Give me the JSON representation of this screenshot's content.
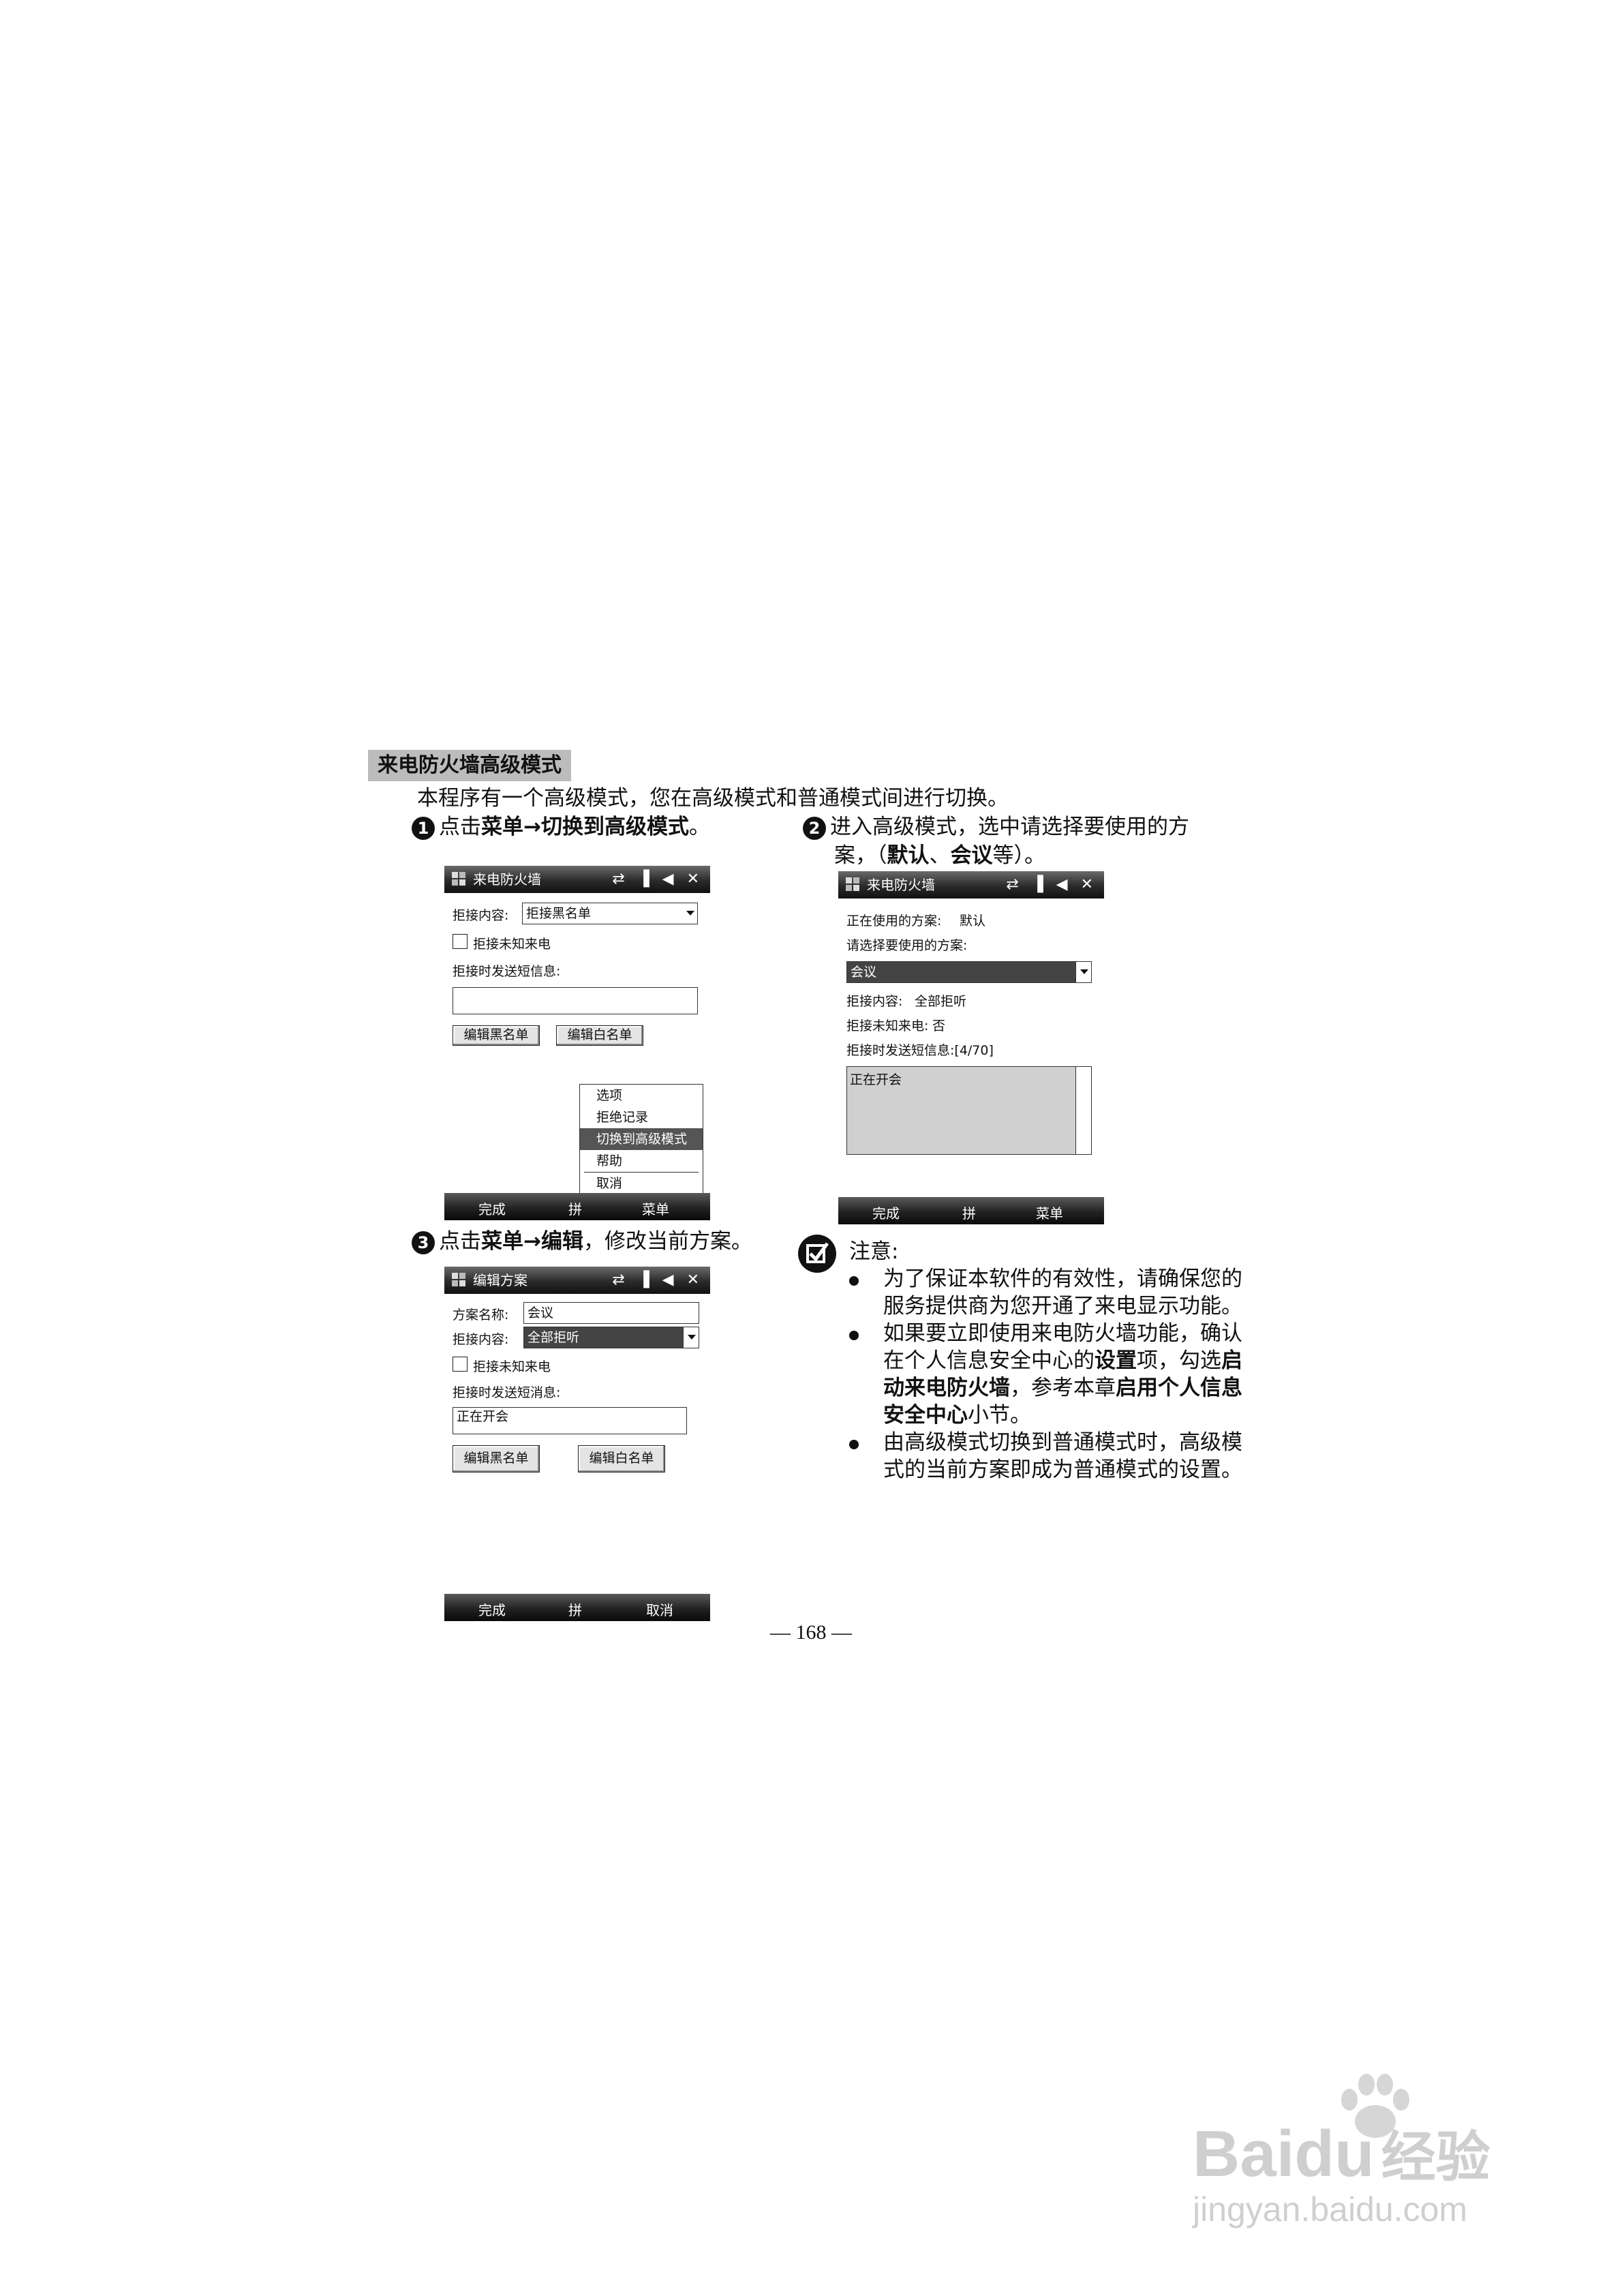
{
  "section_title": "来电防火墙高级模式",
  "intro": "本程序有一个高级模式，您在高级模式和普通模式间进行切换。",
  "step1": {
    "num": "1",
    "pre": "点击",
    "b1": "菜单",
    "arrow": "→",
    "b2": "切换到高级模式",
    "post": "。"
  },
  "step2": {
    "num": "2",
    "line1": "进入高级模式，选中请选择要使用的方",
    "line2_pre": "案，（",
    "b1": "默认",
    "sep": "、",
    "b2": "会议",
    "line2_post": "等）。"
  },
  "step3": {
    "num": "3",
    "pre": "点击",
    "b1": "菜单",
    "arrow": "→",
    "b2": "编辑",
    "post": "，修改当前方案。"
  },
  "screen1": {
    "title": "来电防火墙",
    "status_icons": "⇄ ▐ ◀ ✕",
    "reject_content_label": "拒接内容:",
    "reject_content_value": "拒接黑名单",
    "reject_unknown_label": "拒接未知来电",
    "sms_label": "拒接时发送短信息:",
    "sms_value": "",
    "btn_black": "编辑黑名单",
    "btn_white": "编辑白名单",
    "menu": [
      "选项",
      "拒绝记录",
      "切换到高级模式",
      "帮助",
      "取消"
    ],
    "soft_left": "完成",
    "soft_mid": "拼",
    "soft_right": "菜单"
  },
  "screen2": {
    "title": "来电防火墙",
    "status_icons": "⇄ ▐ ◀ ✕",
    "current_label": "正在使用的方案:",
    "current_value": "默认",
    "choose_label": "请选择要使用的方案:",
    "choose_value": "会议",
    "content_label": "拒接内容:",
    "content_value": "全部拒听",
    "unknown_label": "拒接未知来电:",
    "unknown_value": "否",
    "sms_label": "拒接时发送短信息:[4/70]",
    "sms_value": "正在开会",
    "soft_left": "完成",
    "soft_mid": "拼",
    "soft_right": "菜单"
  },
  "screen3": {
    "title": "编辑方案",
    "status_icons": "⇄ ▐ ◀ ✕",
    "name_label": "方案名称:",
    "name_value": "会议",
    "content_label": "拒接内容:",
    "content_value": "全部拒听",
    "unknown_label": "拒接未知来电",
    "sms_label": "拒接时发送短消息:",
    "sms_value": "正在开会",
    "btn_black": "编辑黑名单",
    "btn_white": "编辑白名单",
    "soft_left": "完成",
    "soft_mid": "拼",
    "soft_right": "取消"
  },
  "note": {
    "title": "注意:",
    "b1": "为了保证本软件的有效性，请确保您的服务提供商为您开通了来电显示功能。",
    "b1_l1": "为了保证本软件的有效性，请确保您的",
    "b1_l2": "服务提供商为您开通了来电显示功能。",
    "b2_l1": "如果要立即使用来电防火墙功能，确认",
    "b2_l2_pre": "在个人信息安全中心的",
    "b2_l2_b": "设置",
    "b2_l2_mid": "项，勾选",
    "b2_l2_b2": "启",
    "b2_l3_b": "动来电防火墙",
    "b2_l3_mid": "，参考本章",
    "b2_l3_b2": "启用个人信息",
    "b2_l4_b": "安全中心",
    "b2_l4_post": "小节。",
    "b3_l1": "由高级模式切换到普通模式时，高级模",
    "b3_l2": "式的当前方案即成为普通模式的设置。"
  },
  "page_number": "— 168 —",
  "watermark": {
    "brand": "Bai",
    "brand2": "du",
    "cn": "经验",
    "url": "jingyan.baidu.com"
  }
}
